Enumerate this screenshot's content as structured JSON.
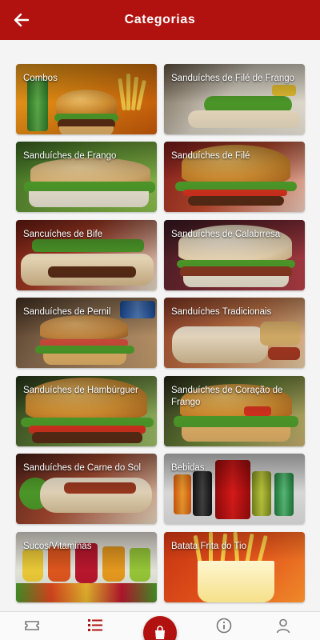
{
  "header": {
    "title": "Categorias"
  },
  "categories": [
    {
      "label": "Combos"
    },
    {
      "label": "Sanduíches de Filé de Frango"
    },
    {
      "label": "Sanduíches de Frango"
    },
    {
      "label": "Sanduíches de Filé"
    },
    {
      "label": "Sancuíches de Bife"
    },
    {
      "label": "Sanduíches de Calabrresa"
    },
    {
      "label": "Sanduíches de Pernil"
    },
    {
      "label": "Sanduíches Tradicionais"
    },
    {
      "label": "Sanduíches de Hambúrguer"
    },
    {
      "label": "Sanduíches de Coração de Frango"
    },
    {
      "label": "Sanduíches de Carne do Sol"
    },
    {
      "label": "Bebidas"
    },
    {
      "label": "Sucos/Vitaminas"
    },
    {
      "label": "Batata Frita do Tio"
    }
  ],
  "nav": {
    "items": [
      "ticket-icon",
      "list-icon",
      "bag-icon",
      "info-icon",
      "user-icon"
    ]
  },
  "colors": {
    "primary": "#b1120f"
  }
}
